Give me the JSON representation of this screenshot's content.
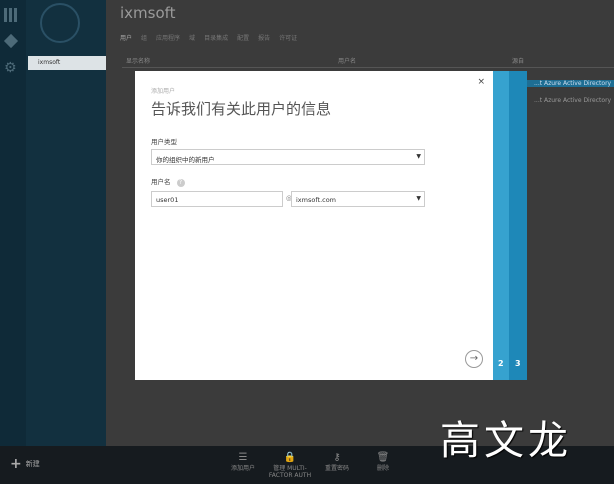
{
  "app": {
    "title": "ixmsoft",
    "nav_item": "ixmsoft"
  },
  "tabs": [
    "用户",
    "组",
    "应用程序",
    "域",
    "目录集成",
    "配置",
    "报告",
    "许可证"
  ],
  "columns": [
    "显示名称",
    "用户名",
    "源自"
  ],
  "rows": [
    {
      "source": "...t Azure Active Directory"
    },
    {
      "source": "...t Azure Active Directory"
    }
  ],
  "dialog": {
    "breadcrumb": "添加用户",
    "heading": "告诉我们有关此用户的信息",
    "user_type_label": "用户类型",
    "user_type_value": "你的组织中的新用户",
    "username_label": "用户名",
    "username_value": "user01",
    "at": "@",
    "domain_value": "ixmsoft.com",
    "close": "×",
    "next": "→",
    "steps": [
      "2",
      "3"
    ]
  },
  "bottom": {
    "new": "新建",
    "commands": [
      "添加用户",
      "管理 MULTI-FACTOR AUTH",
      "重置密码",
      "删除"
    ]
  },
  "watermark": "高文龙"
}
